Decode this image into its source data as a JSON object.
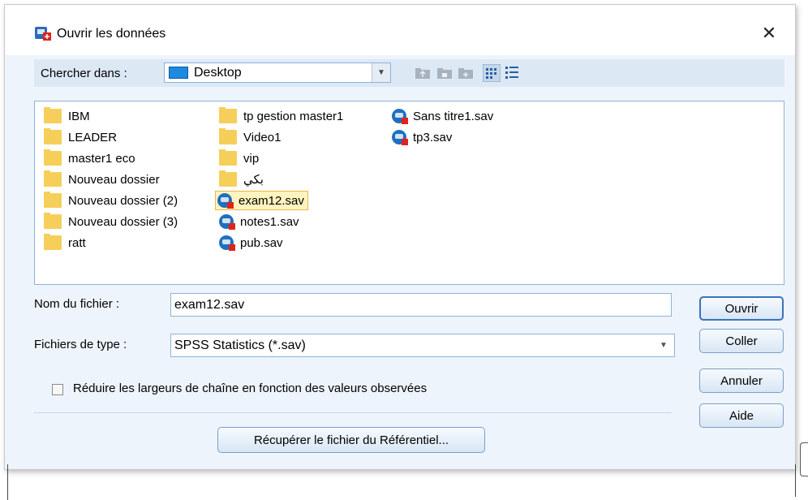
{
  "window": {
    "title": "Ouvrir les données"
  },
  "toolbar": {
    "look_in_label": "Chercher dans :",
    "location": "Desktop",
    "icons": [
      "up-folder-icon",
      "new-folder-icon",
      "list-view-icon",
      "details-view-icon"
    ]
  },
  "files": {
    "col1": [
      "IBM",
      "LEADER",
      "master1 eco",
      "Nouveau dossier",
      "Nouveau dossier (2)",
      "Nouveau dossier (3)",
      "ratt"
    ],
    "col2": [
      "tp gestion master1",
      "Video1",
      "vip",
      "بكي",
      "exam12.sav",
      "notes1.sav",
      "pub.sav"
    ],
    "col3": [
      "Sans titre1.sav",
      "tp3.sav"
    ],
    "selected": "exam12.sav"
  },
  "form": {
    "filename_label": "Nom du fichier :",
    "filename_value": "exam12.sav",
    "filetype_label": "Fichiers de type :",
    "filetype_value": "SPSS Statistics (*.sav)",
    "reduce_label": "Réduire les largeurs de chaîne en fonction des valeurs observées",
    "reduce_checked": false,
    "repository_button": "Récupérer le fichier du Référentiel..."
  },
  "buttons": {
    "open": "Ouvrir",
    "paste": "Coller",
    "cancel": "Annuler",
    "help": "Aide"
  },
  "colors": {
    "panel": "#eef4fb",
    "toolbar": "#dde8f5",
    "border": "#8fb2d9",
    "folder": "#f6cf5b",
    "selection": "#fff3bf"
  }
}
